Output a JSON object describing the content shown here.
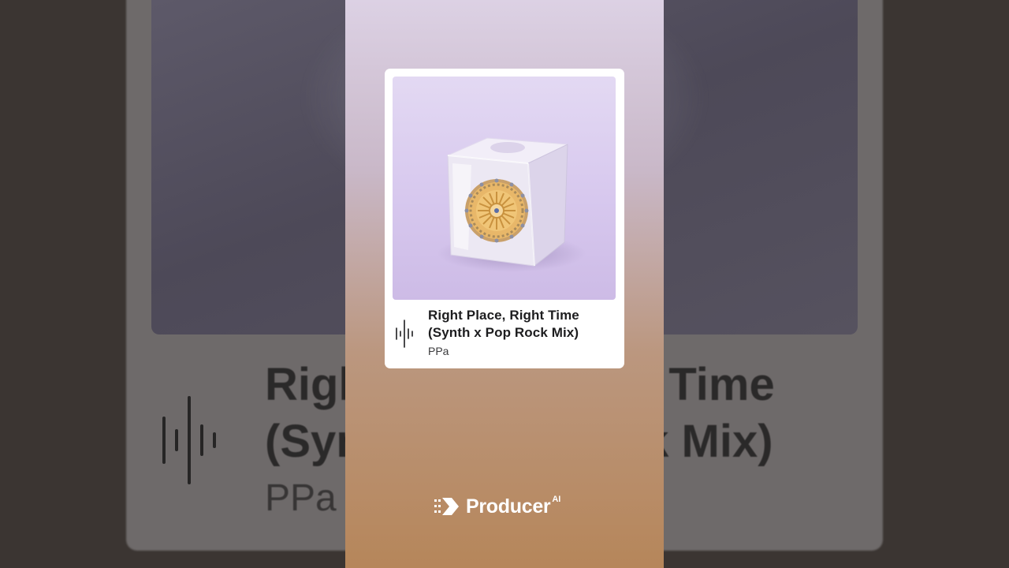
{
  "track": {
    "title_line1": "Right Place, Right Time",
    "title_line2": "(Synth x Pop Rock Mix)",
    "artist": "PPa"
  },
  "background_echo": {
    "title_line1": "Right Place, Right Time",
    "title_line2": "(Synth x Pop Rock Mix)",
    "artist": "PPa"
  },
  "brand": {
    "name": "Producer",
    "superscript": "AI",
    "logo_icon": "producer-logo-icon"
  },
  "icons": {
    "waveform": "waveform-icon"
  },
  "colors": {
    "card_bg": "#ffffff",
    "panel_top": "#dcd1e4",
    "panel_bottom": "#b6865a",
    "title_text": "#1d1d1f",
    "art_bg": "#d7c8ee"
  }
}
